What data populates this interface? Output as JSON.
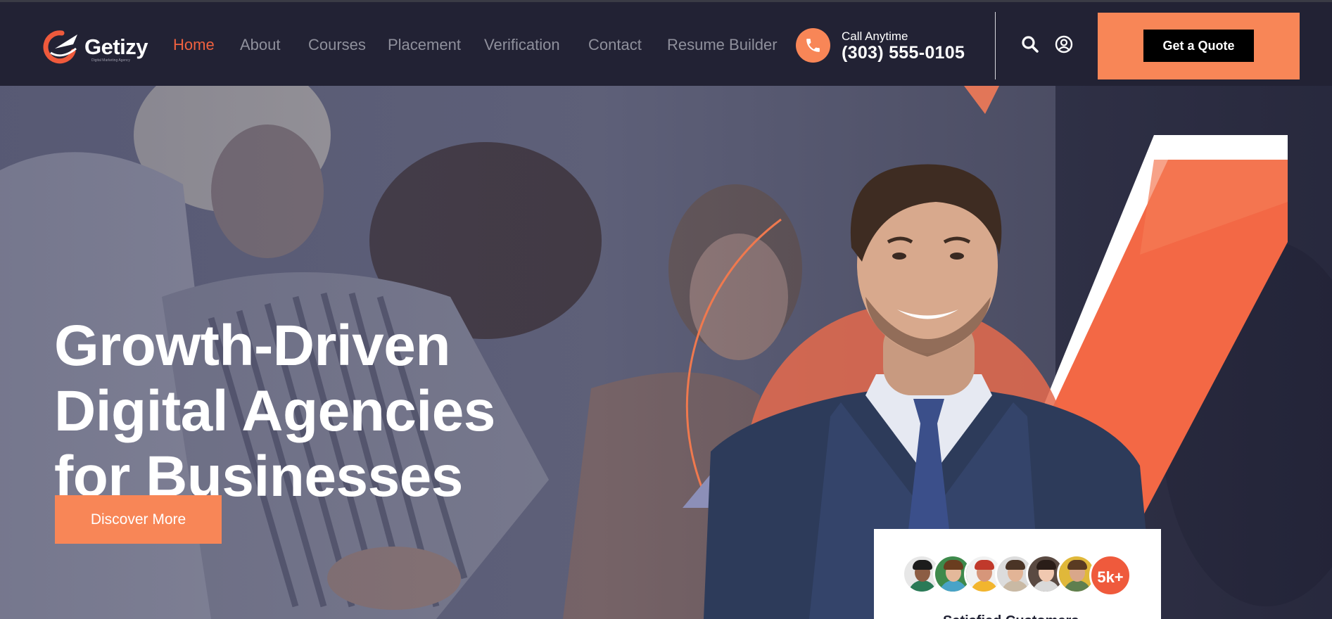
{
  "brand": {
    "name": "Getizy",
    "tagline": "Digital Marketing Agency",
    "accent": "#f88657",
    "active_nav": "#f0613f",
    "dark": "#222234"
  },
  "nav": {
    "items": [
      {
        "label": "Home",
        "active": true
      },
      {
        "label": "About",
        "active": false
      },
      {
        "label": "Courses",
        "active": false
      },
      {
        "label": "Placement",
        "active": false
      },
      {
        "label": "Verification",
        "active": false
      },
      {
        "label": "Contact",
        "active": false
      },
      {
        "label": "Resume Builder",
        "active": false
      }
    ]
  },
  "contact": {
    "icon": "phone-icon",
    "label": "Call Anytime",
    "number": "(303) 555-0105"
  },
  "header_icons": [
    "search-icon",
    "user-icon"
  ],
  "cta": {
    "quote_label": "Get a Quote"
  },
  "hero": {
    "title_lines": [
      "Growth-Driven",
      "Digital Agencies",
      "for Businesses"
    ],
    "button_label": "Discover More"
  },
  "proof": {
    "count": "5k+",
    "caption": "Satisfied Customers"
  }
}
